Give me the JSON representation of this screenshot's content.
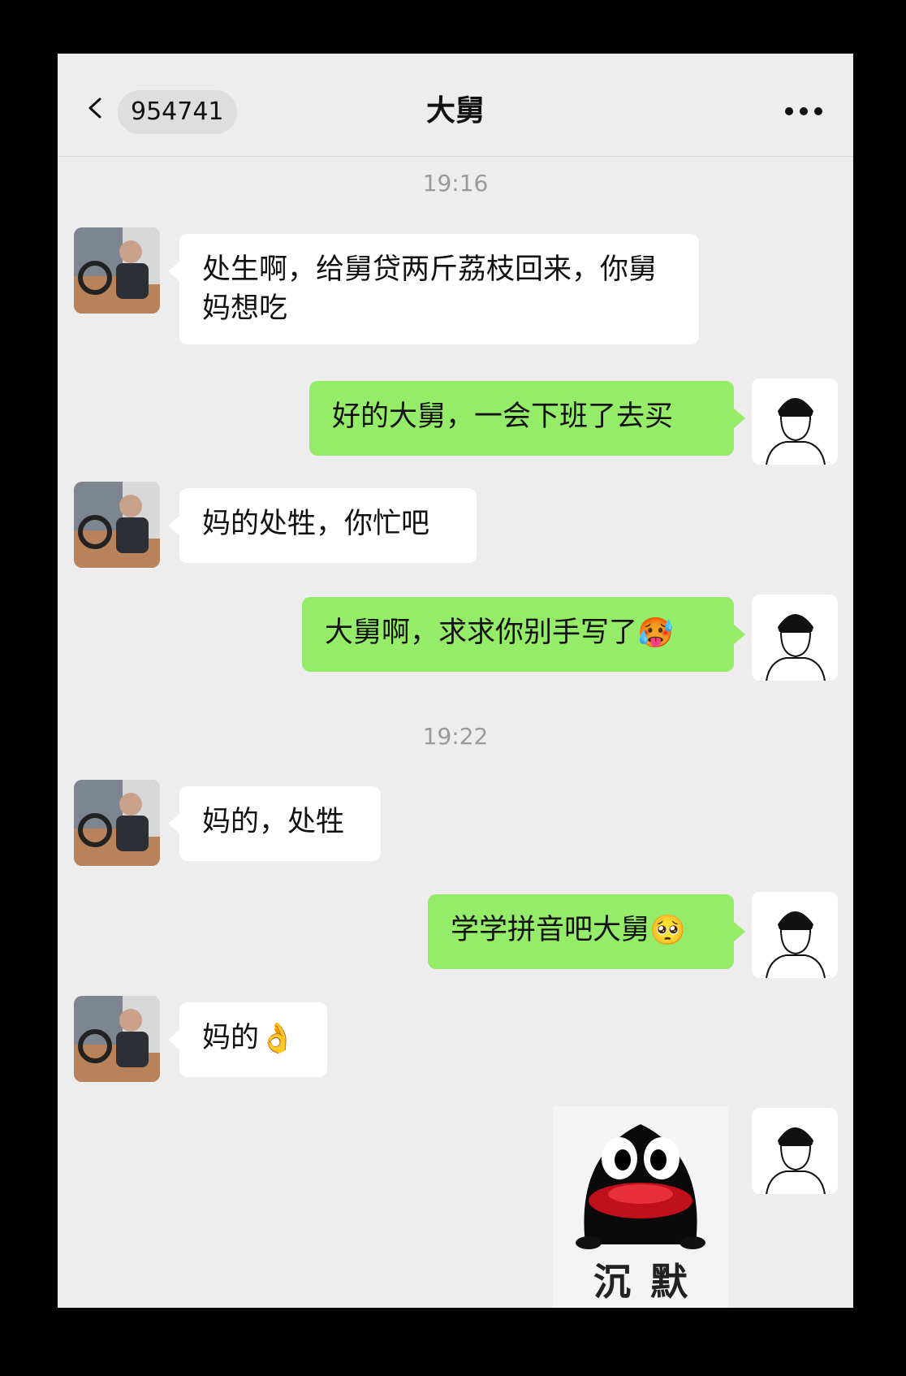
{
  "header": {
    "unread_count": "954741",
    "title": "大舅"
  },
  "messages": [
    {
      "type": "timestamp",
      "text": "19:16"
    },
    {
      "type": "incoming",
      "text": "处生啊，给舅贷两斤荔枝回来，你舅妈想吃"
    },
    {
      "type": "outgoing",
      "text": "好的大舅，一会下班了去买"
    },
    {
      "type": "incoming",
      "text": "妈的处牲，你忙吧"
    },
    {
      "type": "outgoing",
      "text": "大舅啊，求求你别手写了",
      "emoji": "🥵"
    },
    {
      "type": "timestamp",
      "text": "19:22"
    },
    {
      "type": "incoming",
      "text": "妈的，处牲"
    },
    {
      "type": "outgoing",
      "text": "学学拼音吧大舅",
      "emoji": "🥺"
    },
    {
      "type": "incoming",
      "text": "妈的",
      "emoji": "👌"
    },
    {
      "type": "outgoing-sticker",
      "text": "沉默"
    }
  ],
  "colors": {
    "outgoing_bubble": "#95ec69",
    "incoming_bubble": "#ffffff",
    "background": "#ededed"
  }
}
